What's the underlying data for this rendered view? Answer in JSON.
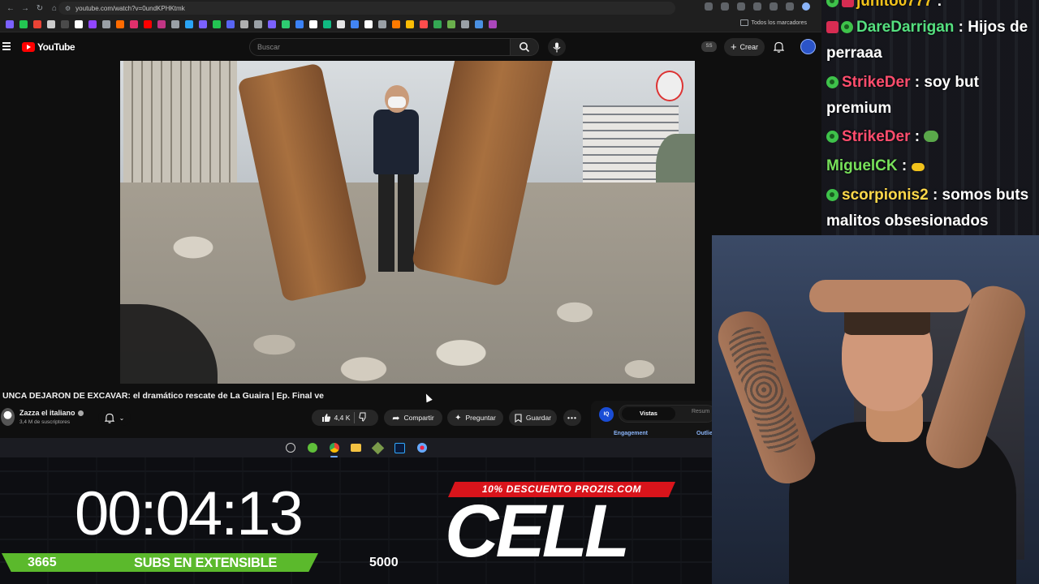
{
  "browser": {
    "url": "youtube.com/watch?v=0undKPHKtmk",
    "bookmarks_folder": "Todos los marcadores"
  },
  "youtube": {
    "logo_text": "YouTube",
    "search_placeholder": "Buscar",
    "ss_badge": "SS",
    "create_label": "Crear",
    "video_title": "UNCA DEJARON DE EXCAVAR: el dramático rescate de La Guaira | Ep. Final ve",
    "channel_name": "Zazza el italiano",
    "subscribers": "3,4 M de suscriptores",
    "likes": "4,4 K",
    "share_label": "Compartir",
    "ask_label": "Preguntar",
    "save_label": "Guardar",
    "more_label": "•••",
    "panel": {
      "iq_label": "IQ",
      "active_tab": "Vistas",
      "other_tab": "Resum",
      "engagement_label": "Engagement",
      "outlier_label": "Outlie"
    }
  },
  "overlay": {
    "timer": "00:04:13",
    "subs_current": "3665",
    "subs_label": "SUBS EN EXTENSIBLE",
    "subs_goal": "5000",
    "subs_progress": 0.733,
    "promo": "10% DESCUENTO PROZIS.COM",
    "sponsor": "CELL"
  },
  "chat": {
    "messages": [
      {
        "user": "junito0777",
        "text": ":",
        "color": "#f1c21b"
      },
      {
        "user": "DareDarrigan",
        "text": ": Hijos de perraaa",
        "color": "#55e07f"
      },
      {
        "user": "StrikeDer",
        "text": ": soy but premium",
        "color": "#ff4d6d"
      },
      {
        "user": "StrikeDer",
        "text": ":",
        "color": "#ff4d6d"
      },
      {
        "user": "MiguelCK",
        "text": ":",
        "color": "#77e05a"
      },
      {
        "user": "scorpionis2",
        "text": ": somos buts malitos obsesionados",
        "color": "#ffd84a"
      }
    ]
  },
  "colors": {
    "yt_red": "#ff0000",
    "subs_bar": "#5bb92c",
    "promo_red": "#d9141b"
  }
}
